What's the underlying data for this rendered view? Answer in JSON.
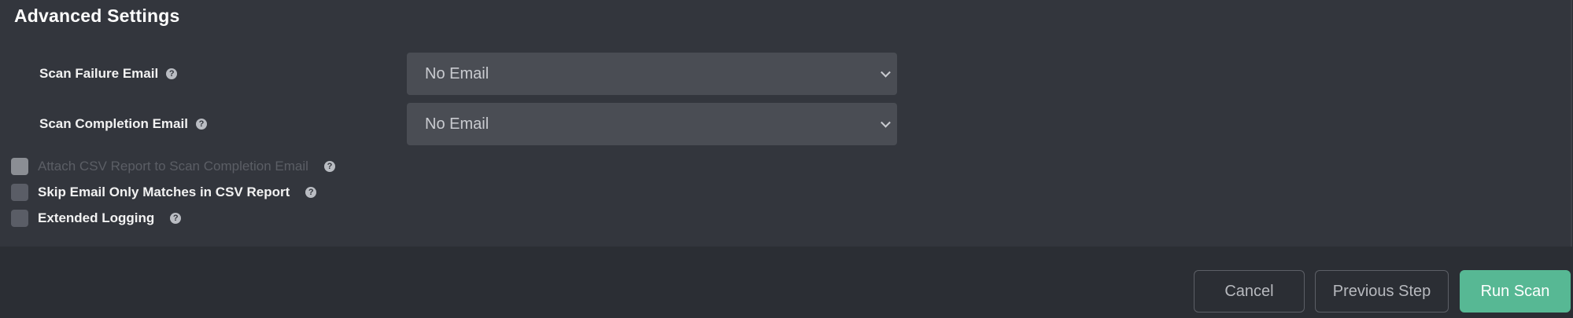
{
  "advanced_settings": {
    "title": "Advanced Settings",
    "scan_failure_email": {
      "label": "Scan Failure Email",
      "value": "No Email"
    },
    "scan_completion_email": {
      "label": "Scan Completion Email",
      "value": "No Email"
    },
    "options": [
      {
        "label": "Attach CSV Report to Scan Completion Email",
        "checked": false,
        "disabled": true
      },
      {
        "label": "Skip Email Only Matches in CSV Report",
        "checked": false,
        "disabled": false
      },
      {
        "label": "Extended Logging",
        "checked": false,
        "disabled": false
      }
    ]
  },
  "footer": {
    "cancel_label": "Cancel",
    "previous_label": "Previous Step",
    "run_label": "Run Scan"
  },
  "colors": {
    "primary_button": "#57b894",
    "panel_background": "#33363d",
    "page_background": "#2b2e34"
  },
  "icons": {
    "help": "question-circle-icon",
    "dropdown": "chevron-down-icon"
  }
}
